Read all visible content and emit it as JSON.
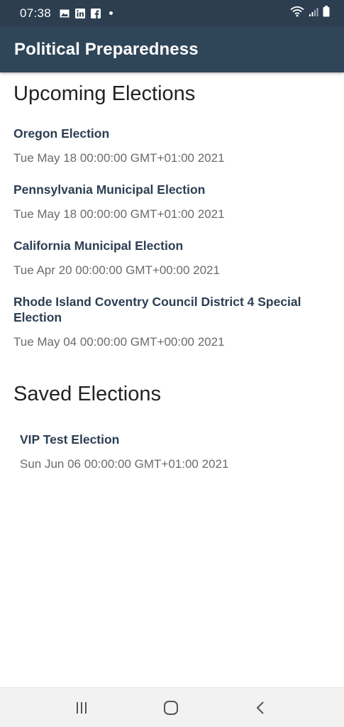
{
  "status_bar": {
    "time": "07:38",
    "notification_icons": [
      "gallery-icon",
      "linkedin-icon",
      "facebook-icon",
      "dot-icon"
    ],
    "system_icons": [
      "wifi-icon",
      "signal-icon",
      "battery-icon"
    ]
  },
  "app_bar": {
    "title": "Political Preparedness"
  },
  "upcoming": {
    "heading": "Upcoming Elections",
    "items": [
      {
        "name": "Oregon Election",
        "date": "Tue May 18 00:00:00 GMT+01:00 2021"
      },
      {
        "name": "Pennsylvania Municipal Election",
        "date": "Tue May 18 00:00:00 GMT+01:00 2021"
      },
      {
        "name": "California Municipal Election",
        "date": "Tue Apr 20 00:00:00 GMT+00:00 2021"
      },
      {
        "name": "Rhode Island Coventry Council District 4 Special Election",
        "date": "Tue May 04 00:00:00 GMT+00:00 2021"
      }
    ]
  },
  "saved": {
    "heading": "Saved Elections",
    "items": [
      {
        "name": "VIP Test Election",
        "date": "Sun Jun 06 00:00:00 GMT+01:00 2021"
      }
    ]
  },
  "nav_bar": {
    "buttons": [
      "recent-apps-icon",
      "home-icon",
      "back-icon"
    ]
  },
  "colors": {
    "status_bar": "#2d3e50",
    "app_bar": "#2f4558",
    "election_name": "#2c3e52",
    "election_date": "#6b6b6b"
  }
}
